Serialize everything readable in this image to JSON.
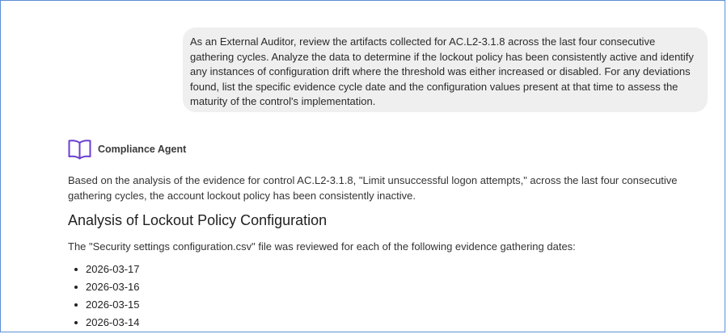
{
  "user_message": {
    "text": "As an External Auditor, review the artifacts collected for AC.L2-3.1.8 across the last four consecutive gathering cycles. Analyze the data to determine if the lockout policy has been consistently active and identify any instances of configuration drift where the threshold was either increased or disabled. For any deviations found, list the specific evidence cycle date and the configuration values present at that time to assess the maturity of the control's implementation."
  },
  "agent": {
    "name": "Compliance Agent",
    "icon": "book-icon",
    "accent_color": "#6a3fd0"
  },
  "response": {
    "intro": "Based on the analysis of the evidence for control AC.L2-3.1.8, \"Limit unsuccessful logon attempts,\" across the last four consecutive gathering cycles, the account lockout policy has been consistently inactive.",
    "heading": "Analysis of Lockout Policy Configuration",
    "files_reviewed": "The \"Security settings configuration.csv\" file was reviewed for each of the following evidence gathering dates:",
    "dates": [
      "2026-03-17",
      "2026-03-16",
      "2026-03-15",
      "2026-03-14"
    ]
  }
}
